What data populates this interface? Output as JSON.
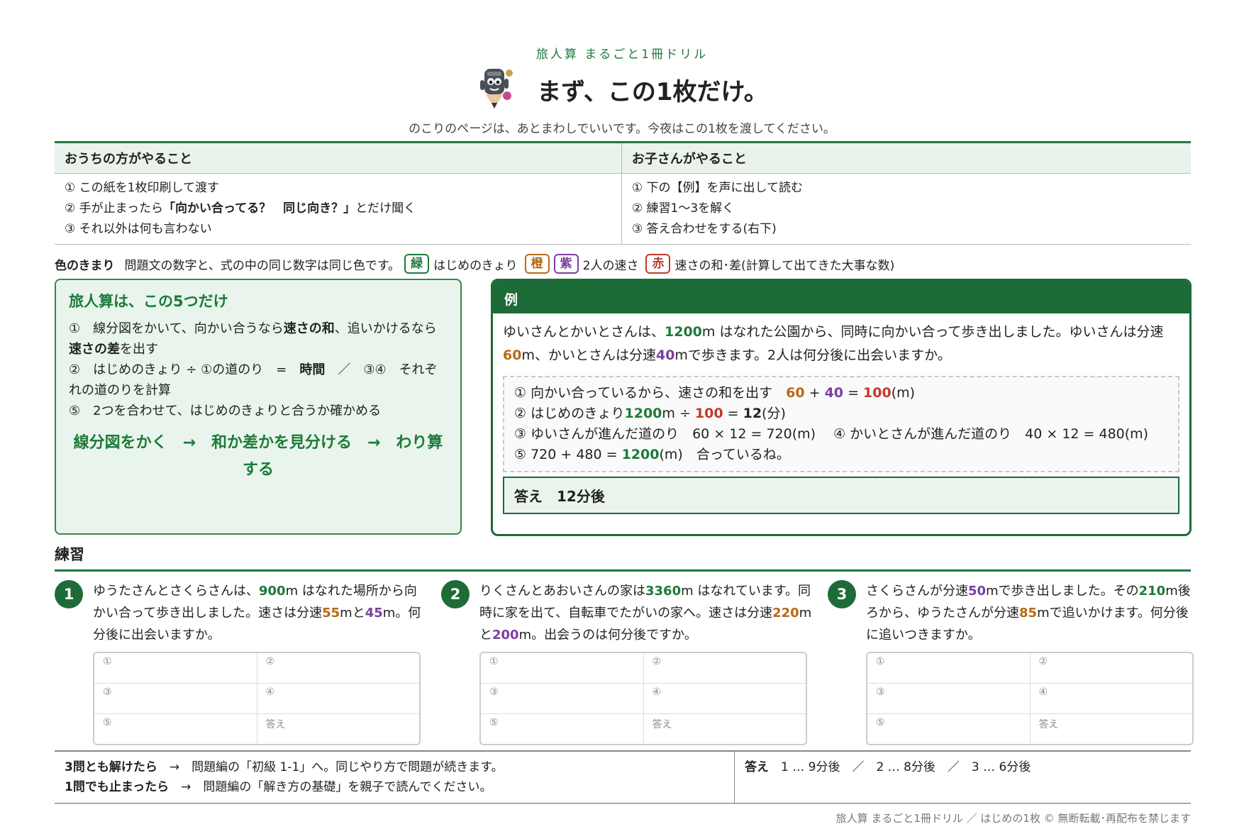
{
  "header": {
    "series": "旅人算 まるごと1冊ドリル",
    "title": "まず、この1枚だけ。",
    "subtitle": "のこりのページは、あとまわしでいいです。今夜はこの1枚を渡してください。"
  },
  "roles": {
    "parent_title": "おうちの方がやること",
    "parent_items": [
      "① この紙を1枚印刷して渡す",
      "② 手が止まったら",
      "「向かい合ってる？　同じ向き？」",
      "とだけ聞く",
      "③ それ以外は何も言わない"
    ],
    "child_title": "お子さんがやること",
    "child_items": [
      "① 下の【例】を声に出して読む",
      "② 練習1〜3を解く",
      "③ 答え合わせをする(右下)"
    ]
  },
  "color_key": {
    "label": "色のきまり",
    "desc": "問題文の数字と、式の中の同じ数字は同じ色です。",
    "green_tag": "緑",
    "green_desc": "はじめのきょり",
    "orange_tag": "橙",
    "purple_tag": "紫",
    "speed_desc": "2人の速さ",
    "red_tag": "赤",
    "red_desc": "速さの和･差(計算して出てきた大事な数)",
    "colors": {
      "green": "#1d7a3a",
      "orange": "#b86a12",
      "purple": "#7a3fa0",
      "red": "#c0392b"
    }
  },
  "steps": {
    "title": "旅人算は、この5つだけ",
    "s1a": "①　線分図をかいて、向かい合うなら",
    "s1b": "速さの和",
    "s1c": "、追いかけるなら",
    "s1d": "速さの差",
    "s1e": "を出す",
    "s2a": "②　はじめのきょり ÷ ①の道のり　=　",
    "s2b": "時間",
    "s2c": "　／　③④　それぞれの道のりを計算",
    "s3": "⑤　2つを合わせて、はじめのきょりと合うか確かめる",
    "flow": "線分図をかく　→　和か差かを見分ける　→　わり算する"
  },
  "example": {
    "label": "例",
    "p1": "ゆいさんとかいとさんは、",
    "dist": "1200",
    "p2": "m はなれた公園から、同時に向かい合って歩き出しました。ゆいさんは分速",
    "v1": "60",
    "p3": "m、かいとさんは分速",
    "v2": "40",
    "p4": "mで歩きます。2人は何分後に出会いますか。",
    "l1a": "① 向かい合っているから、速さの和を出す　",
    "l1b": "60",
    "l1c": " + ",
    "l1d": "40",
    "l1e": " = ",
    "l1f": "100",
    "l1g": "(m)",
    "l2a": "② はじめのきょり",
    "l2b": "1200",
    "l2c": "m ÷ ",
    "l2d": "100",
    "l2e": " = ",
    "l2f": "12",
    "l2g": "(分)",
    "l3": "③ ゆいさんが進んだ道のり　60 × 12 = 720(m)　 ④ かいとさんが進んだ道のり　40 × 12 = 480(m)",
    "l4a": "⑤ 720 + 480 = ",
    "l4b": "1200",
    "l4c": "(m)　合っているね。",
    "answer": "答え　12分後"
  },
  "practice": {
    "heading": "練習",
    "cells": {
      "c1": "①",
      "c2": "②",
      "c3": "③",
      "c4": "④",
      "c5": "⑤",
      "ans": "答え"
    },
    "q1": {
      "num": "1",
      "a": "ゆうたさんとさくらさんは、",
      "b": "900",
      "c": "m はなれた場所から向かい合って歩き出しました。速さは分速",
      "d": "55",
      "e": "mと",
      "f": "45",
      "g": "m。何分後に出会いますか。"
    },
    "q2": {
      "num": "2",
      "a": "りくさんとあおいさんの家は",
      "b": "3360",
      "c": "m はなれています。同時に家を出て、自転車でたがいの家へ。速さは分速",
      "d": "220",
      "e": "mと",
      "f": "200",
      "g": "m。出会うのは何分後ですか。"
    },
    "q3": {
      "num": "3",
      "a": "さくらさんが分速",
      "b": "50",
      "c": "mで歩き出しました。その",
      "d": "210",
      "e": "m後ろから、ゆうたさんが分速",
      "f": "85",
      "g": "mで追いかけます。何分後に追いつきますか。"
    }
  },
  "bottom": {
    "l1a": "3問とも解けたら",
    "l1b": "　→　問題編の「初級 1-1」へ。同じやり方で問題が続きます。",
    "l2a": "1問でも止まったら",
    "l2b": "　→　問題編の「解き方の基礎」を親子で読んでください。",
    "ans_label": "答え",
    "ans_text": "　1 … 9分後　／　2 … 8分後　／　3 … 6分後"
  },
  "footer": "旅人算 まるごと1冊ドリル ／ はじめの1枚 © 無断転載･再配布を禁じます"
}
